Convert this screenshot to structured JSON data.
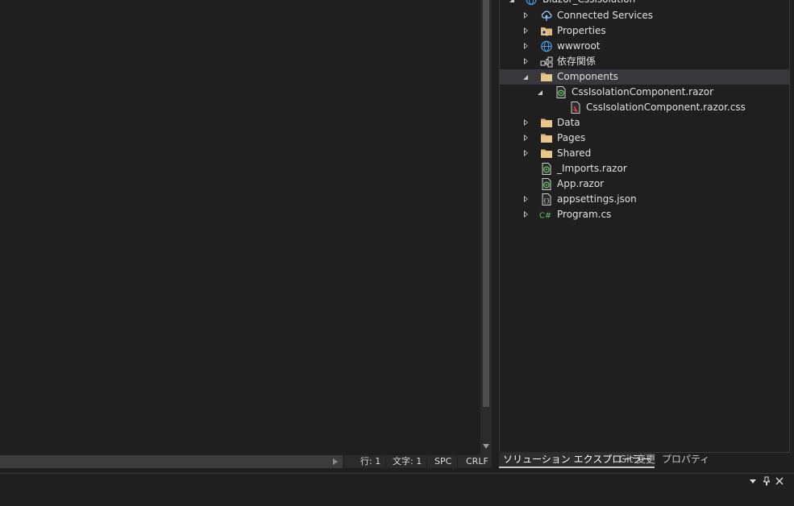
{
  "status_bar": {
    "line": "行: 1",
    "char": "文字: 1",
    "whitespace": "SPC",
    "line_ending": "CRLF"
  },
  "solution_explorer": {
    "project": "Blazor_CssIsolation",
    "items": [
      {
        "label": "Connected Services",
        "icon": "connected-services-icon"
      },
      {
        "label": "Properties",
        "icon": "properties-icon"
      },
      {
        "label": "wwwroot",
        "icon": "globe-icon"
      },
      {
        "label": "依存関係",
        "icon": "dependencies-icon"
      },
      {
        "label": "Components",
        "icon": "folder-icon"
      },
      {
        "label": "CssIsolationComponent.razor",
        "icon": "razor-file-icon"
      },
      {
        "label": "CssIsolationComponent.razor.css",
        "icon": "css-file-icon"
      },
      {
        "label": "Data",
        "icon": "folder-icon"
      },
      {
        "label": "Pages",
        "icon": "folder-icon"
      },
      {
        "label": "Shared",
        "icon": "folder-icon"
      },
      {
        "label": "_Imports.razor",
        "icon": "razor-file-icon"
      },
      {
        "label": "App.razor",
        "icon": "razor-file-icon"
      },
      {
        "label": "appsettings.json",
        "icon": "json-file-icon"
      },
      {
        "label": "Program.cs",
        "icon": "csharp-file-icon"
      }
    ]
  },
  "tabs": {
    "solution_explorer": "ソリューション エクスプローラー",
    "git_changes": "Git 変更",
    "properties": "プロパティ"
  },
  "colors": {
    "background": "#1f1f1f",
    "selection": "#37373d",
    "folder": "#dcb67a",
    "razor": "#5fb85f",
    "csharp": "#67c467"
  }
}
